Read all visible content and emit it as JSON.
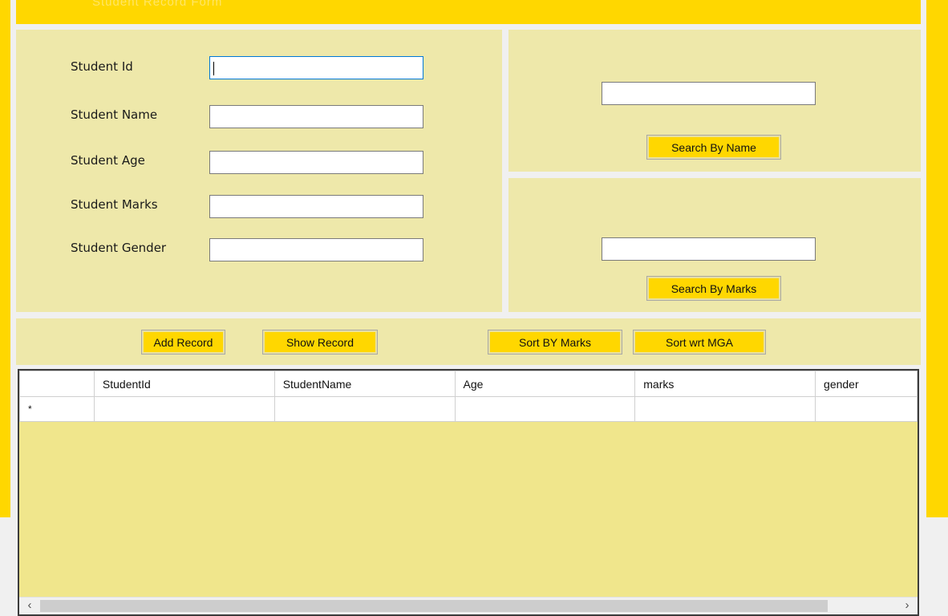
{
  "header": {
    "title": "Student Record Form"
  },
  "form": {
    "fields": [
      {
        "label": "Student Id",
        "value": ""
      },
      {
        "label": "Student Name",
        "value": ""
      },
      {
        "label": "Student Age",
        "value": ""
      },
      {
        "label": "Student Marks",
        "value": ""
      },
      {
        "label": "Student Gender",
        "value": ""
      }
    ]
  },
  "search_name": {
    "value": "",
    "button_label": "Search By Name"
  },
  "search_marks": {
    "value": "",
    "button_label": "Search By Marks"
  },
  "actions": {
    "add_label": "Add Record",
    "show_label": "Show Record",
    "sort_marks_label": "Sort BY Marks",
    "sort_mga_label": "Sort wrt MGA"
  },
  "grid": {
    "columns": [
      "StudentId",
      "StudentName",
      "Age",
      "marks",
      "gender"
    ],
    "new_row_marker": "*",
    "scroll_left_icon": "chevron-left-icon",
    "scroll_right_icon": "chevron-right-icon"
  },
  "colors": {
    "accent": "#ffd700",
    "panel": "#eee8aa",
    "grid_background": "#f0e68c"
  }
}
